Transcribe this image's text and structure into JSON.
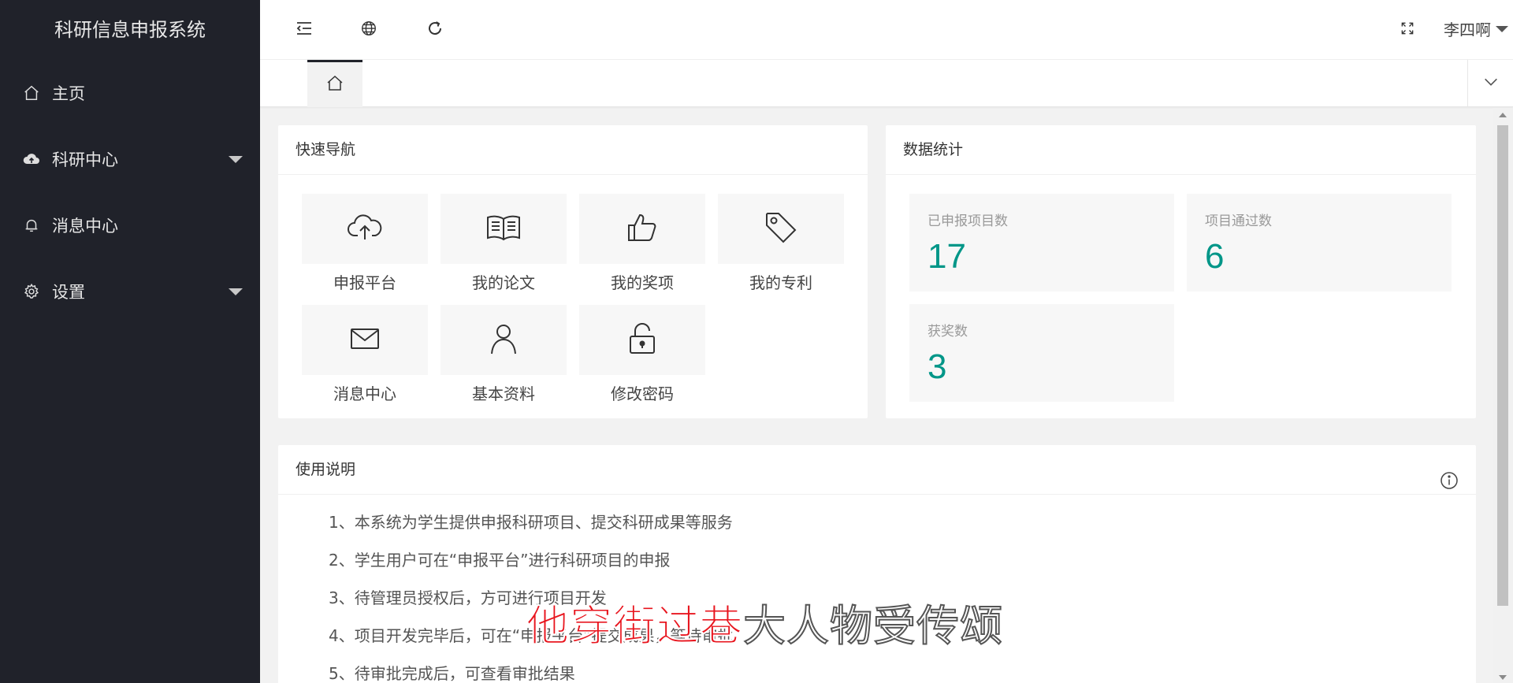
{
  "app": {
    "title": "科研信息申报系统"
  },
  "sidebar": {
    "items": [
      {
        "label": "主页",
        "icon": "home-icon",
        "has_submenu": false
      },
      {
        "label": "科研中心",
        "icon": "cloud-icon",
        "has_submenu": true
      },
      {
        "label": "消息中心",
        "icon": "bell-icon",
        "has_submenu": false
      },
      {
        "label": "设置",
        "icon": "gear-icon",
        "has_submenu": true
      }
    ]
  },
  "header": {
    "icons": [
      "menu-collapse-icon",
      "globe-icon",
      "refresh-icon",
      "fullscreen-icon"
    ],
    "user_name": "李四啊"
  },
  "tabs": {
    "home_icon": "home-icon",
    "more_icon": "chevron-down-icon"
  },
  "quick_nav": {
    "title": "快速导航",
    "items": [
      {
        "label": "申报平台",
        "icon": "cloud-upload-icon"
      },
      {
        "label": "我的论文",
        "icon": "book-icon"
      },
      {
        "label": "我的奖项",
        "icon": "thumbs-up-icon"
      },
      {
        "label": "我的专利",
        "icon": "tag-icon"
      },
      {
        "label": "消息中心",
        "icon": "mail-icon"
      },
      {
        "label": "基本资料",
        "icon": "user-icon"
      },
      {
        "label": "修改密码",
        "icon": "unlock-icon"
      }
    ]
  },
  "stats": {
    "title": "数据统计",
    "items": [
      {
        "label": "已申报项目数",
        "value": "17"
      },
      {
        "label": "项目通过数",
        "value": "6"
      },
      {
        "label": "获奖数",
        "value": "3"
      }
    ]
  },
  "instructions": {
    "title": "使用说明",
    "lines": [
      "1、本系统为学生提供申报科研项目、提交科研成果等服务",
      "2、学生用户可在“申报平台”进行科研项目的申报",
      "3、待管理员授权后，方可进行项目开发",
      "4、项目开发完毕后，可在“申报平台”提交成果，等待审批",
      "5、待审批完成后，可查看审批结果"
    ]
  },
  "subtitle": {
    "highlighted": "他穿街过巷",
    "rest": "大人物受传颂"
  },
  "colors": {
    "sidebar_bg": "#20222a",
    "accent": "#009688",
    "subtitle_red": "#e8141d"
  }
}
